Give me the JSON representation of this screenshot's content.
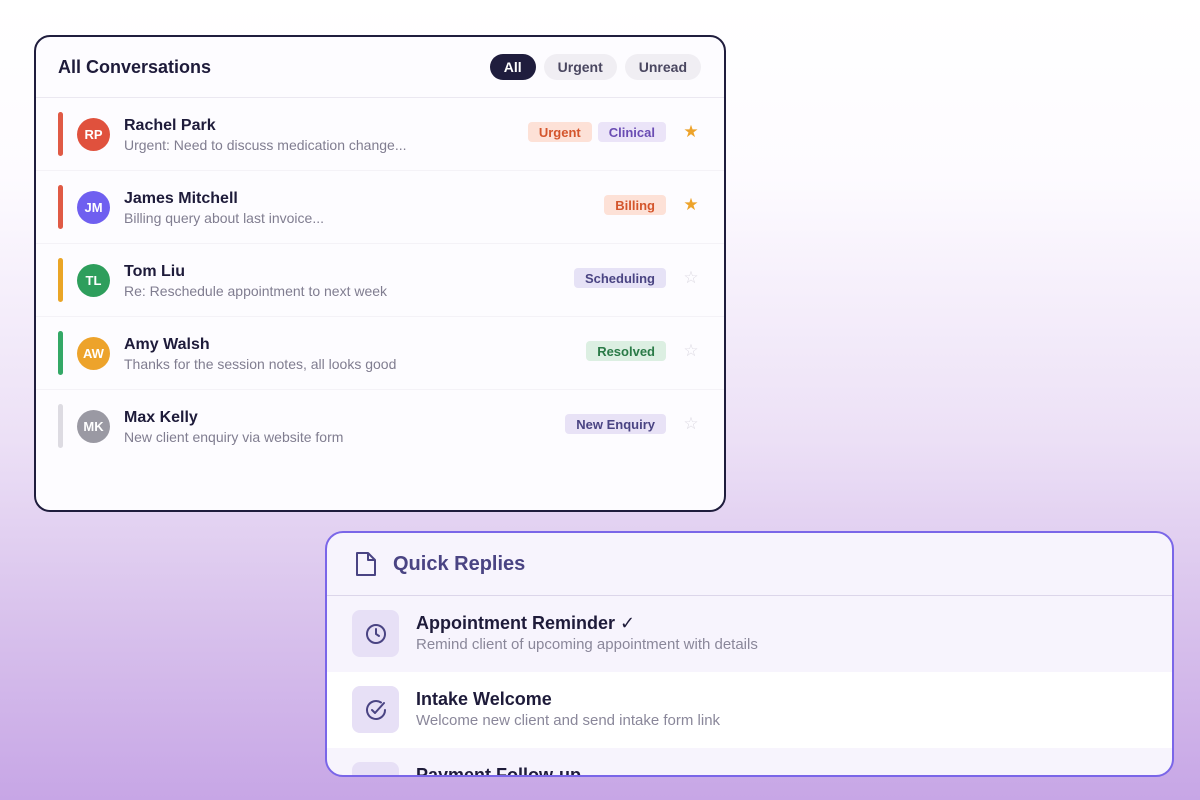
{
  "conversations": {
    "title": "All Conversations",
    "filters": [
      {
        "label": "All",
        "active": true
      },
      {
        "label": "Urgent",
        "active": false
      },
      {
        "label": "Unread",
        "active": false
      }
    ],
    "items": [
      {
        "initials": "RP",
        "name": "Rachel Park",
        "preview": "Urgent: Need to discuss medication change...",
        "bar_color": "#e05a45",
        "avatar_color": "#e0513d",
        "tags": [
          {
            "label": "Urgent",
            "kind": "urgent"
          },
          {
            "label": "Clinical",
            "kind": "clinical"
          }
        ],
        "starred": true
      },
      {
        "initials": "JM",
        "name": "James Mitchell",
        "preview": "Billing query about last invoice...",
        "bar_color": "#e05a45",
        "avatar_color": "#6f5ff0",
        "tags": [
          {
            "label": "Billing",
            "kind": "billing"
          }
        ],
        "starred": true
      },
      {
        "initials": "TL",
        "name": "Tom Liu",
        "preview": "Re: Reschedule appointment to next week",
        "bar_color": "#eaa526",
        "avatar_color": "#2e9e5c",
        "tags": [
          {
            "label": "Scheduling",
            "kind": "scheduling"
          }
        ],
        "starred": false
      },
      {
        "initials": "AW",
        "name": "Amy Walsh",
        "preview": "Thanks for the session notes, all looks good",
        "bar_color": "#34a866",
        "avatar_color": "#eda32b",
        "tags": [
          {
            "label": "Resolved",
            "kind": "resolved"
          }
        ],
        "starred": false
      },
      {
        "initials": "MK",
        "name": "Max Kelly",
        "preview": "New client enquiry via website form",
        "bar_color": "#dddbe2",
        "avatar_color": "#9a99a3",
        "tags": [
          {
            "label": "New Enquiry",
            "kind": "enquiry"
          }
        ],
        "starred": false
      }
    ]
  },
  "quick_replies": {
    "title": "Quick Replies",
    "header_icon": "document-icon",
    "items": [
      {
        "name": "Appointment Reminder ✓",
        "desc": "Remind client of upcoming appointment with details",
        "icon": "clock-icon"
      },
      {
        "name": "Intake Welcome",
        "desc": "Welcome new client and send intake form link",
        "icon": "check-circle-icon"
      },
      {
        "name": "Payment Follow-up",
        "desc": "",
        "icon": "payment-icon"
      }
    ]
  },
  "icons": {
    "star_on": "★",
    "star_off": "☆"
  },
  "colors": {
    "dark_navy": "#1f1d3d",
    "accent_purple": "#7a66e8",
    "star_gold": "#eda32b"
  }
}
